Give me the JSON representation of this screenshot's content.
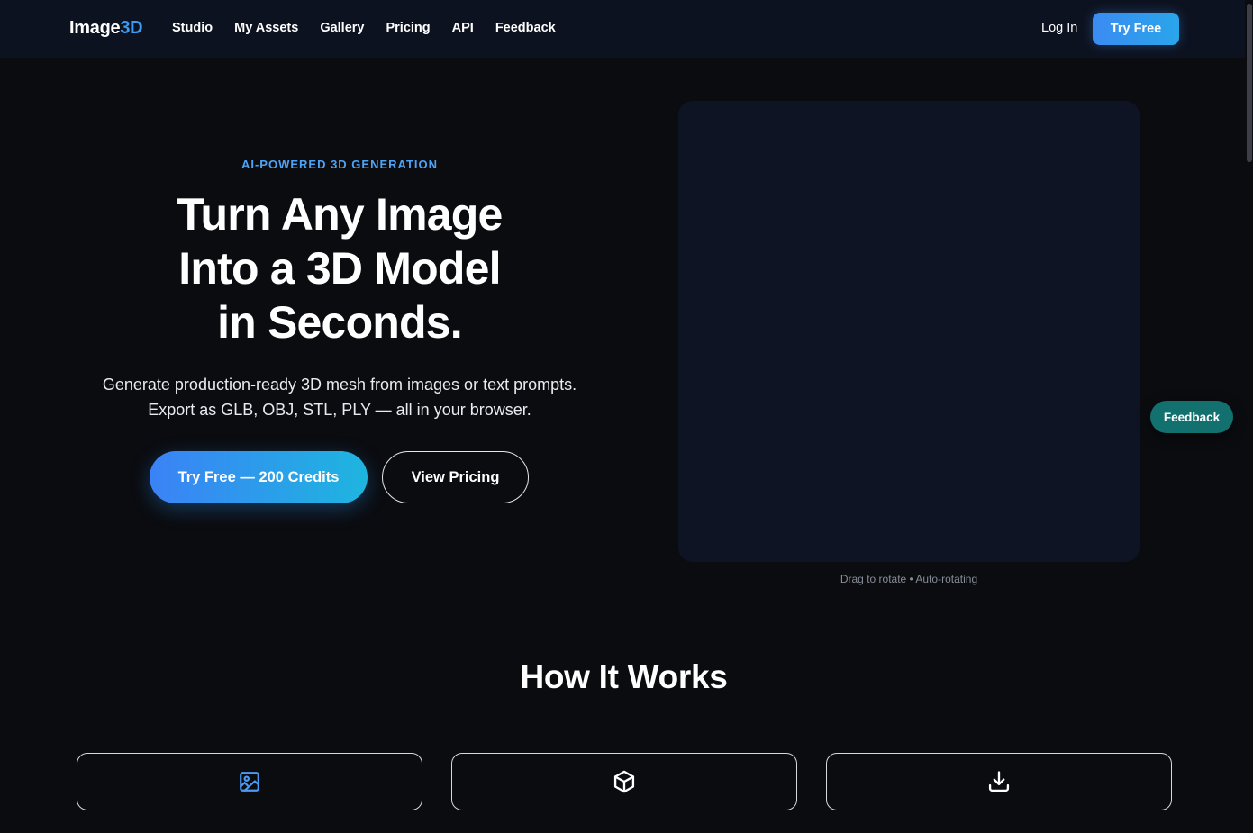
{
  "nav": {
    "logo_part1": "Image",
    "logo_part2": "3D",
    "links": [
      "Studio",
      "My Assets",
      "Gallery",
      "Pricing",
      "API",
      "Feedback"
    ],
    "login_label": "Log In",
    "try_free_label": "Try Free"
  },
  "hero": {
    "eyebrow": "AI-POWERED 3D GENERATION",
    "title_lines": [
      "Turn Any Image",
      "Into a 3D Model",
      "in Seconds."
    ],
    "subtitle_lines": [
      "Generate production-ready 3D mesh from images or text prompts.",
      "Export as GLB, OBJ, STL, PLY — all in your browser."
    ],
    "primary_cta": "Try Free — 200 Credits",
    "secondary_cta": "View Pricing"
  },
  "viewer": {
    "caption": "Drag to rotate • Auto-rotating"
  },
  "feedback_float_label": "Feedback",
  "how_it_works": {
    "title": "How It Works",
    "steps": [
      {
        "icon": "image-icon"
      },
      {
        "icon": "cube-icon"
      },
      {
        "icon": "download-icon"
      }
    ]
  },
  "colors": {
    "background": "#0b0c10",
    "nav_background": "#0d1220",
    "accent_blue": "#3b9cf5",
    "feedback_teal": "#12706f",
    "viewer_bg": "#0e1424"
  }
}
